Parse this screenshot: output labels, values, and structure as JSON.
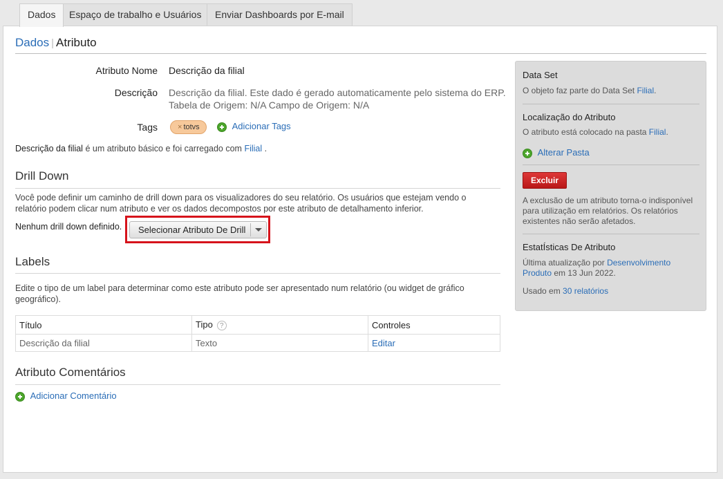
{
  "tabs": [
    "Dados",
    "Espaço de trabalho e Usuários",
    "Enviar Dashboards por E-mail"
  ],
  "breadcrumb": {
    "root": "Dados",
    "separator": "|",
    "current": "Atributo"
  },
  "attribute": {
    "name_label": "Atributo Nome",
    "name_value": "Descrição da filial",
    "desc_label": "Descrição",
    "desc_value": "Descrição da filial. Este dado é gerado automaticamente pelo sistema do ERP. Tabela de Origem: N/A Campo de Origem: N/A",
    "tags_label": "Tags",
    "tag": "totvs",
    "tag_remove": "×",
    "add_tags": "Adicionar Tags",
    "basic_name": "Descrição da filial",
    "basic_text": "é um atributo básico e foi carregado com",
    "basic_link": "Filial",
    "basic_end": "."
  },
  "drill": {
    "title": "Drill Down",
    "text": "Você pode definir um caminho de drill down para os visualizadores do seu relatório. Os usuários que estejam vendo o relatório podem clicar num atributo e ver os dados decompostos por este atributo de detalhamento inferior.",
    "none": "Nenhum drill down definido.",
    "select": "Selecionar Atributo De Drill"
  },
  "labels": {
    "title": "Labels",
    "text": "Edite o tipo de um label para determinar como este atributo pode ser apresentado num relatório (ou widget de gráfico geográfico).",
    "columns": [
      "Título",
      "Tipo",
      "Controles"
    ],
    "help": "?",
    "rows": [
      {
        "title": "Descrição da filial",
        "type": "Texto",
        "control": "Editar"
      }
    ]
  },
  "comments": {
    "title": "Atributo Comentários",
    "add": "Adicionar Comentário"
  },
  "sidebar": {
    "dataset_title": "Data Set",
    "dataset_text": "O objeto faz parte do Data Set",
    "dataset_link": "Filial",
    "dataset_end": ".",
    "loc_title": "Localização do Atributo",
    "loc_text": "O atributo está colocado na pasta",
    "loc_link": "Filial",
    "loc_end": ".",
    "change_folder": "Alterar Pasta",
    "delete": "Excluir",
    "delete_text": "A exclusão de um atributo torna-o indisponível para utilização em relatórios. Os relatórios existentes não serão afetados.",
    "stats_title": "EstatÍsticas De Atributo",
    "updated_prefix": "Última atualização por",
    "updated_by": "Desenvolvimento Produto",
    "updated_date": "em 13 Jun 2022.",
    "used_prefix": "Usado em",
    "used_link": "30 relatórios"
  },
  "colors": {
    "link": "#2a6db7",
    "delete": "#c62020",
    "highlight": "#d6131b",
    "tag": "#f7c99b"
  }
}
